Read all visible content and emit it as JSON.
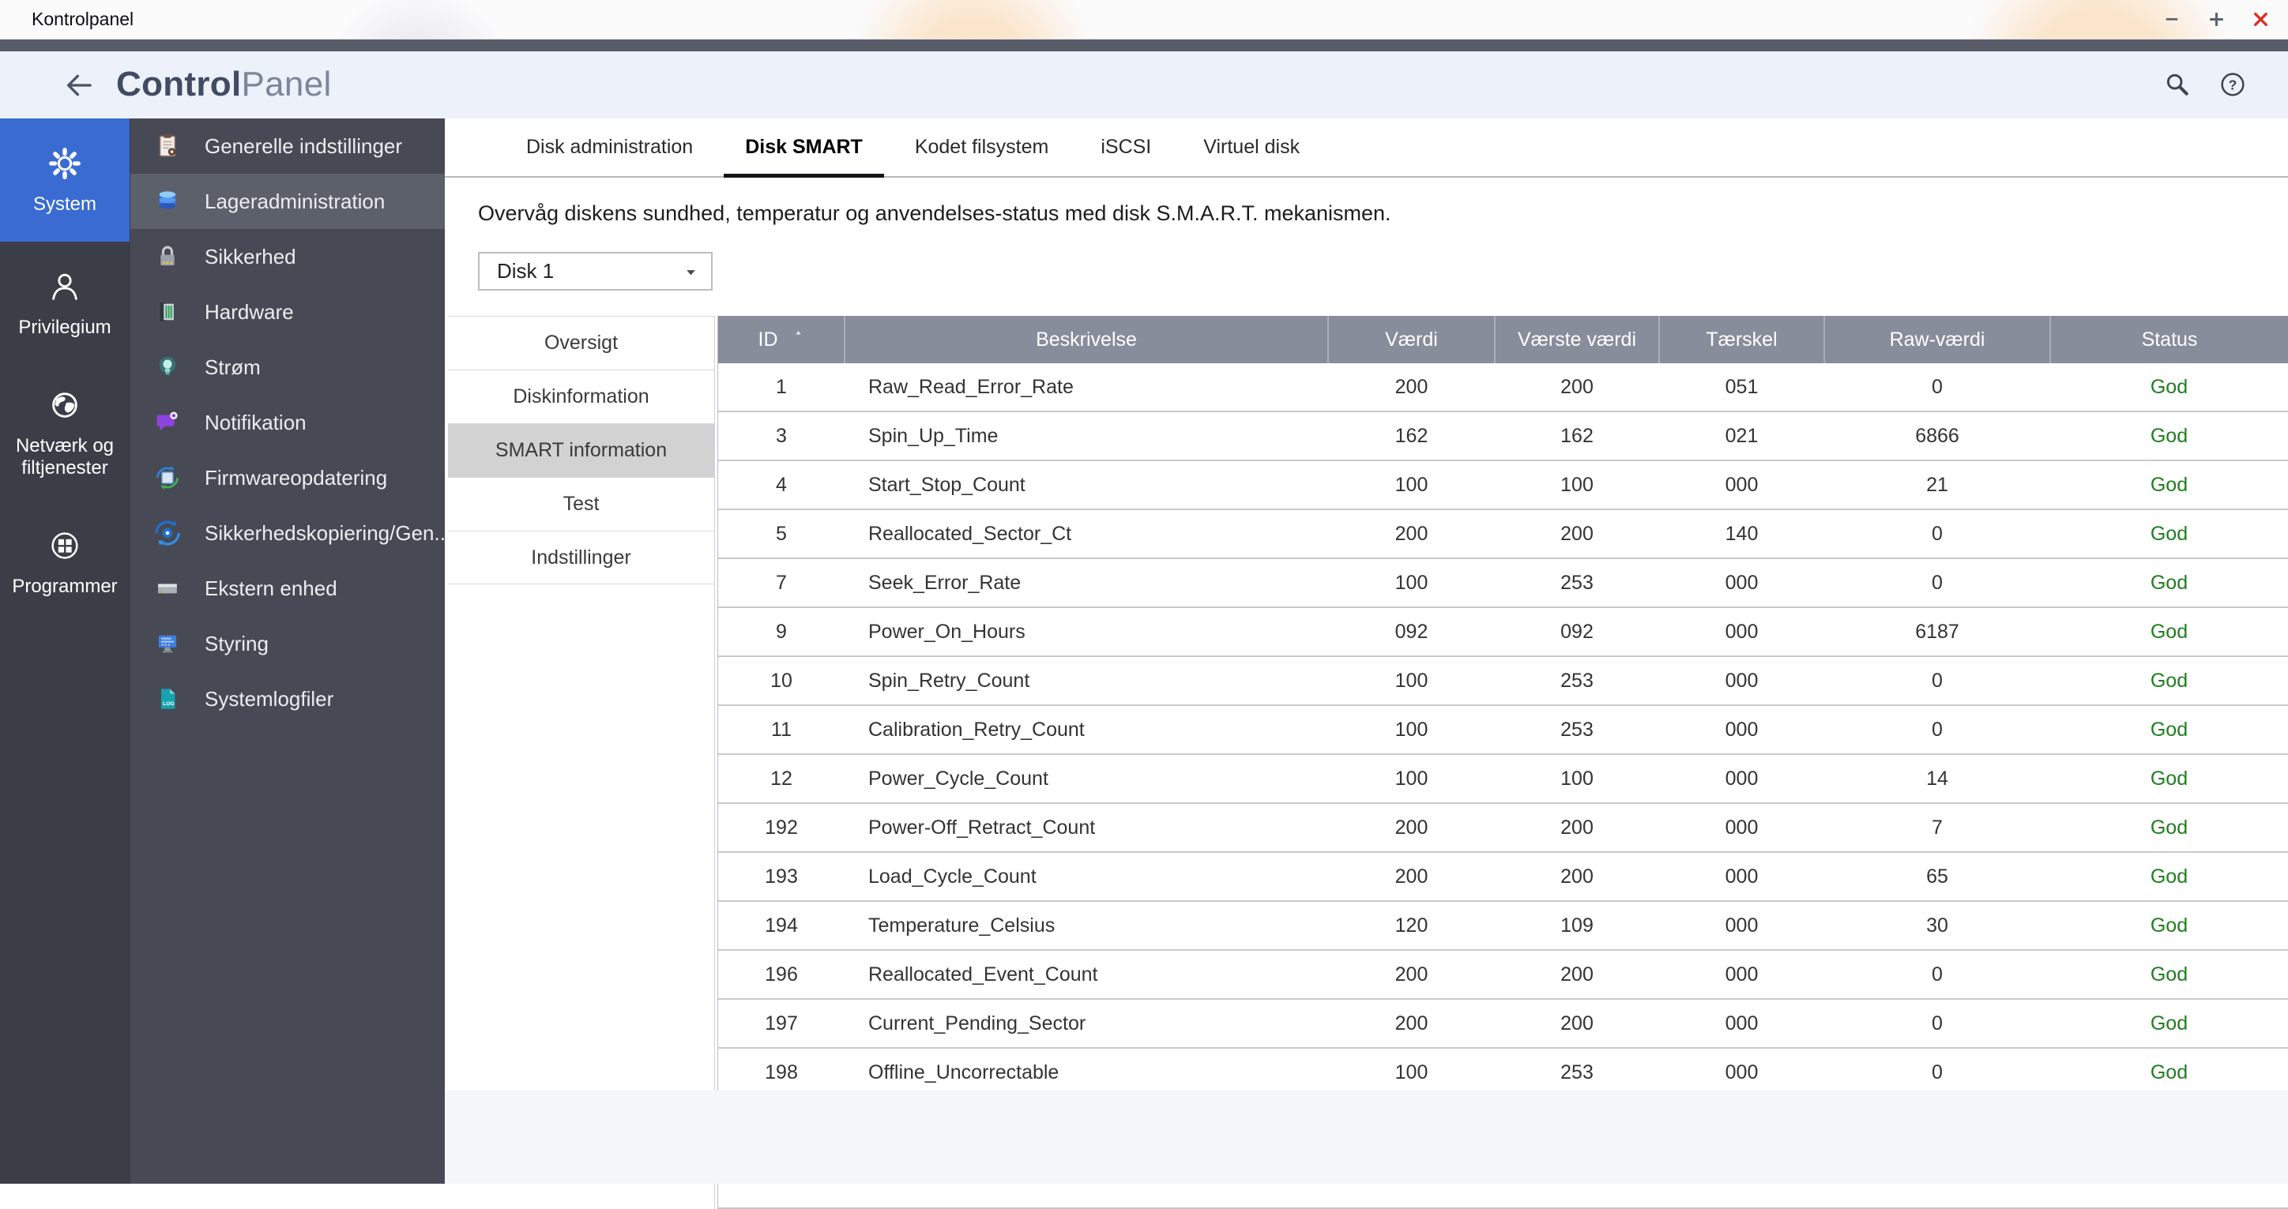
{
  "window": {
    "title": "Kontrolpanel",
    "controls": [
      {
        "name": "minimize-button",
        "icon": "minimize-icon"
      },
      {
        "name": "maximize-button",
        "icon": "maximize-icon"
      },
      {
        "name": "close-button",
        "icon": "close-icon"
      }
    ]
  },
  "header": {
    "title_bold": "Control",
    "title_light": "Panel",
    "back_icon": "back-arrow-icon",
    "search_icon": "search-icon",
    "help_icon": "help-icon"
  },
  "sidebar": {
    "categories": [
      {
        "name": "sidebar-category-system",
        "label": "System",
        "icon": "gear-icon",
        "selected": true
      },
      {
        "name": "sidebar-category-privilegium",
        "label": "Privilegium",
        "icon": "user-icon",
        "selected": false
      },
      {
        "name": "sidebar-category-netvaerk",
        "label": "Netværk og\nfiltjenester",
        "icon": "globe-icon",
        "selected": false
      },
      {
        "name": "sidebar-category-programmer",
        "label": "Programmer",
        "icon": "apps-grid-icon",
        "selected": false
      }
    ],
    "items": [
      {
        "name": "sidebar-item-generelle-indstillinger",
        "label": "Generelle indstillinger",
        "icon": "clipboard-icon",
        "selected": false
      },
      {
        "name": "sidebar-item-lageradministration",
        "label": "Lageradministration",
        "icon": "storage-disks-icon",
        "selected": true
      },
      {
        "name": "sidebar-item-sikkerhed",
        "label": "Sikkerhed",
        "icon": "lock-icon",
        "selected": false
      },
      {
        "name": "sidebar-item-hardware",
        "label": "Hardware",
        "icon": "hardware-icon",
        "selected": false
      },
      {
        "name": "sidebar-item-strom",
        "label": "Strøm",
        "icon": "power-bulb-icon",
        "selected": false
      },
      {
        "name": "sidebar-item-notifikation",
        "label": "Notifikation",
        "icon": "notification-bubble-icon",
        "selected": false
      },
      {
        "name": "sidebar-item-firmwareopdatering",
        "label": "Firmwareopdatering",
        "icon": "firmware-chip-icon",
        "selected": false
      },
      {
        "name": "sidebar-item-sikkerhedskopiering",
        "label": "Sikkerhedskopiering/Gen...",
        "icon": "backup-restore-icon",
        "selected": false
      },
      {
        "name": "sidebar-item-ekstern-enhed",
        "label": "Ekstern enhed",
        "icon": "external-drive-icon",
        "selected": false
      },
      {
        "name": "sidebar-item-styring",
        "label": "Styring",
        "icon": "monitor-icon",
        "selected": false
      },
      {
        "name": "sidebar-item-systemlogfiler",
        "label": "Systemlogfiler",
        "icon": "log-file-icon",
        "selected": false
      }
    ]
  },
  "tabs": [
    {
      "name": "tab-disk-administration",
      "label": "Disk administration",
      "active": false
    },
    {
      "name": "tab-disk-smart",
      "label": "Disk SMART",
      "active": true
    },
    {
      "name": "tab-kodet-filsystem",
      "label": "Kodet filsystem",
      "active": false
    },
    {
      "name": "tab-iscsi",
      "label": "iSCSI",
      "active": false
    },
    {
      "name": "tab-virtuel-disk",
      "label": "Virtuel disk",
      "active": false
    }
  ],
  "smart": {
    "description": "Overvåg diskens sundhed, temperatur og anvendelses-status med disk S.M.A.R.T. mekanismen.",
    "disk_selector": {
      "value": "Disk 1",
      "caret_icon": "caret-down-icon"
    },
    "subnav": [
      {
        "name": "subnav-oversigt",
        "label": "Oversigt",
        "selected": false
      },
      {
        "name": "subnav-diskinformation",
        "label": "Diskinformation",
        "selected": false
      },
      {
        "name": "subnav-smart-information",
        "label": "SMART information",
        "selected": true
      },
      {
        "name": "subnav-test",
        "label": "Test",
        "selected": false
      },
      {
        "name": "subnav-indstillinger",
        "label": "Indstillinger",
        "selected": false
      }
    ],
    "table": {
      "sort_icon": "sort-asc-icon",
      "columns": [
        {
          "label": "ID",
          "sort": "asc"
        },
        {
          "label": "Beskrivelse"
        },
        {
          "label": "Værdi"
        },
        {
          "label": "Værste værdi"
        },
        {
          "label": "Tærskel"
        },
        {
          "label": "Raw-værdi"
        },
        {
          "label": "Status"
        }
      ],
      "rows": [
        [
          "1",
          "Raw_Read_Error_Rate",
          "200",
          "200",
          "051",
          "0",
          "God"
        ],
        [
          "3",
          "Spin_Up_Time",
          "162",
          "162",
          "021",
          "6866",
          "God"
        ],
        [
          "4",
          "Start_Stop_Count",
          "100",
          "100",
          "000",
          "21",
          "God"
        ],
        [
          "5",
          "Reallocated_Sector_Ct",
          "200",
          "200",
          "140",
          "0",
          "God"
        ],
        [
          "7",
          "Seek_Error_Rate",
          "100",
          "253",
          "000",
          "0",
          "God"
        ],
        [
          "9",
          "Power_On_Hours",
          "092",
          "092",
          "000",
          "6187",
          "God"
        ],
        [
          "10",
          "Spin_Retry_Count",
          "100",
          "253",
          "000",
          "0",
          "God"
        ],
        [
          "11",
          "Calibration_Retry_Count",
          "100",
          "253",
          "000",
          "0",
          "God"
        ],
        [
          "12",
          "Power_Cycle_Count",
          "100",
          "100",
          "000",
          "14",
          "God"
        ],
        [
          "192",
          "Power-Off_Retract_Count",
          "200",
          "200",
          "000",
          "7",
          "God"
        ],
        [
          "193",
          "Load_Cycle_Count",
          "200",
          "200",
          "000",
          "65",
          "God"
        ],
        [
          "194",
          "Temperature_Celsius",
          "120",
          "109",
          "000",
          "30",
          "God"
        ],
        [
          "196",
          "Reallocated_Event_Count",
          "200",
          "200",
          "000",
          "0",
          "God"
        ],
        [
          "197",
          "Current_Pending_Sector",
          "200",
          "200",
          "000",
          "0",
          "God"
        ],
        [
          "198",
          "Offline_Uncorrectable",
          "100",
          "253",
          "000",
          "0",
          "God"
        ]
      ]
    }
  },
  "colors": {
    "accent_blue": "#3a6bd2",
    "sidebar_dark": "#3b3e47",
    "sidebar_mid": "#474a54",
    "selected_item_bg": "#5c606b",
    "header_band_bg": "#edf1fa",
    "table_header_bg": "#878d9a",
    "status_good_green": "#1e7e1e",
    "close_red": "#d93025"
  }
}
